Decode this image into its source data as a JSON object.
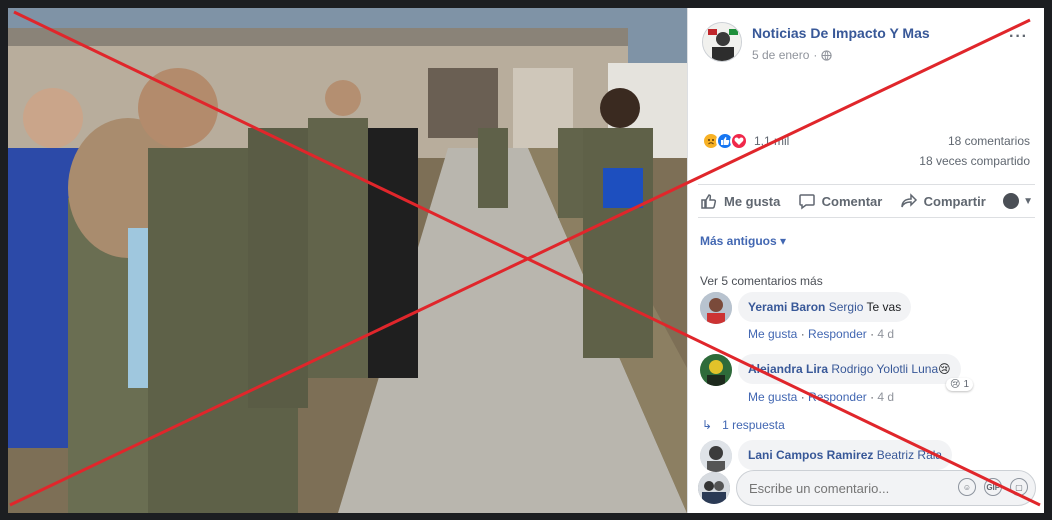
{
  "post": {
    "page_name": "Noticias De Impacto Y Mas",
    "date": "5 de enero",
    "separator": "·",
    "more": "···"
  },
  "stats": {
    "reaction_count": "1,1 mil",
    "comments": "18 comentarios",
    "shares": "18 veces compartido",
    "reaction_icons": [
      "sad-icon",
      "like-icon",
      "love-icon"
    ]
  },
  "actions": {
    "like": "Me gusta",
    "comment": "Comentar",
    "share": "Compartir"
  },
  "sort_label": "Más antiguos ▾",
  "view_more": "Ver 5 comentarios más",
  "comments": [
    {
      "author": "Yerami Baron",
      "tag": "Sergio",
      "text": "Te vas",
      "like": "Me gusta",
      "reply": "Responder",
      "time": "4 d"
    },
    {
      "author": "Alejandra Lira",
      "tag": "Rodrigo Yolotli Luna",
      "text": "😢",
      "like": "Me gusta",
      "reply": "Responder",
      "time": "4 d",
      "reaction_count": "1",
      "replies": "1 respuesta"
    },
    {
      "author": "Lani Campos Ramirez",
      "tag": "Beatriz Rala",
      "text": ""
    }
  ],
  "composer": {
    "placeholder": "Escribe un comentario...",
    "icons": [
      "emoji-icon",
      "gif-icon",
      "sticker-icon"
    ]
  },
  "colors": {
    "link_blue": "#385898",
    "action_blue": "#4267b2",
    "cross_red": "#e0262b"
  }
}
